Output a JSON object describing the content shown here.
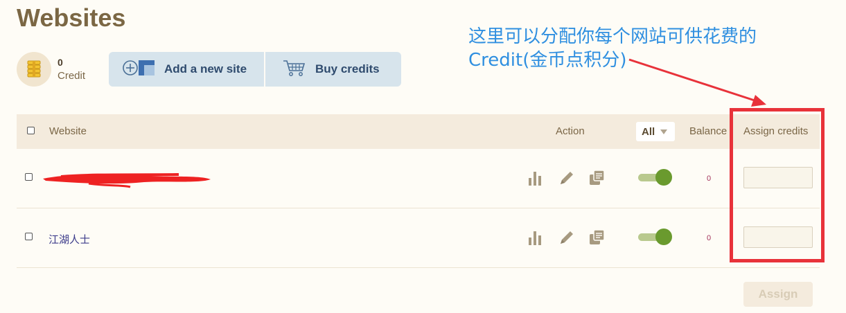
{
  "page": {
    "title": "Websites"
  },
  "credit": {
    "amount": "0",
    "label": "Credit"
  },
  "toolbar": {
    "add_site_label": "Add a new site",
    "buy_credits_label": "Buy credits"
  },
  "annotation": {
    "line1": "这里可以分配你每个网站可供花费的",
    "line2": "Credit(金币点积分)"
  },
  "table": {
    "headers": {
      "website": "Website",
      "action": "Action",
      "filter": "All",
      "balance": "Balance",
      "assign": "Assign credits"
    },
    "rows": [
      {
        "site": "",
        "balance": "0",
        "enabled": true
      },
      {
        "site": "江湖人士",
        "balance": "0",
        "enabled": true
      }
    ]
  },
  "assign_button": {
    "label": "Assign"
  },
  "colors": {
    "background": "#fefcf6",
    "title": "#7b6744",
    "header_bg": "#f4ebdd",
    "button_bg": "#d7e4ec",
    "button_text": "#2f4b6e",
    "toggle_on": "#6a9a2e",
    "annotation_blue": "#2f8fe0",
    "highlight_red": "#e8323a"
  },
  "icons": {
    "credit": "coin-stack-icon",
    "add_site": "add-site-icon",
    "buy": "cart-icon",
    "stats": "bar-chart-icon",
    "edit": "pencil-icon",
    "copy": "copy-icon"
  }
}
